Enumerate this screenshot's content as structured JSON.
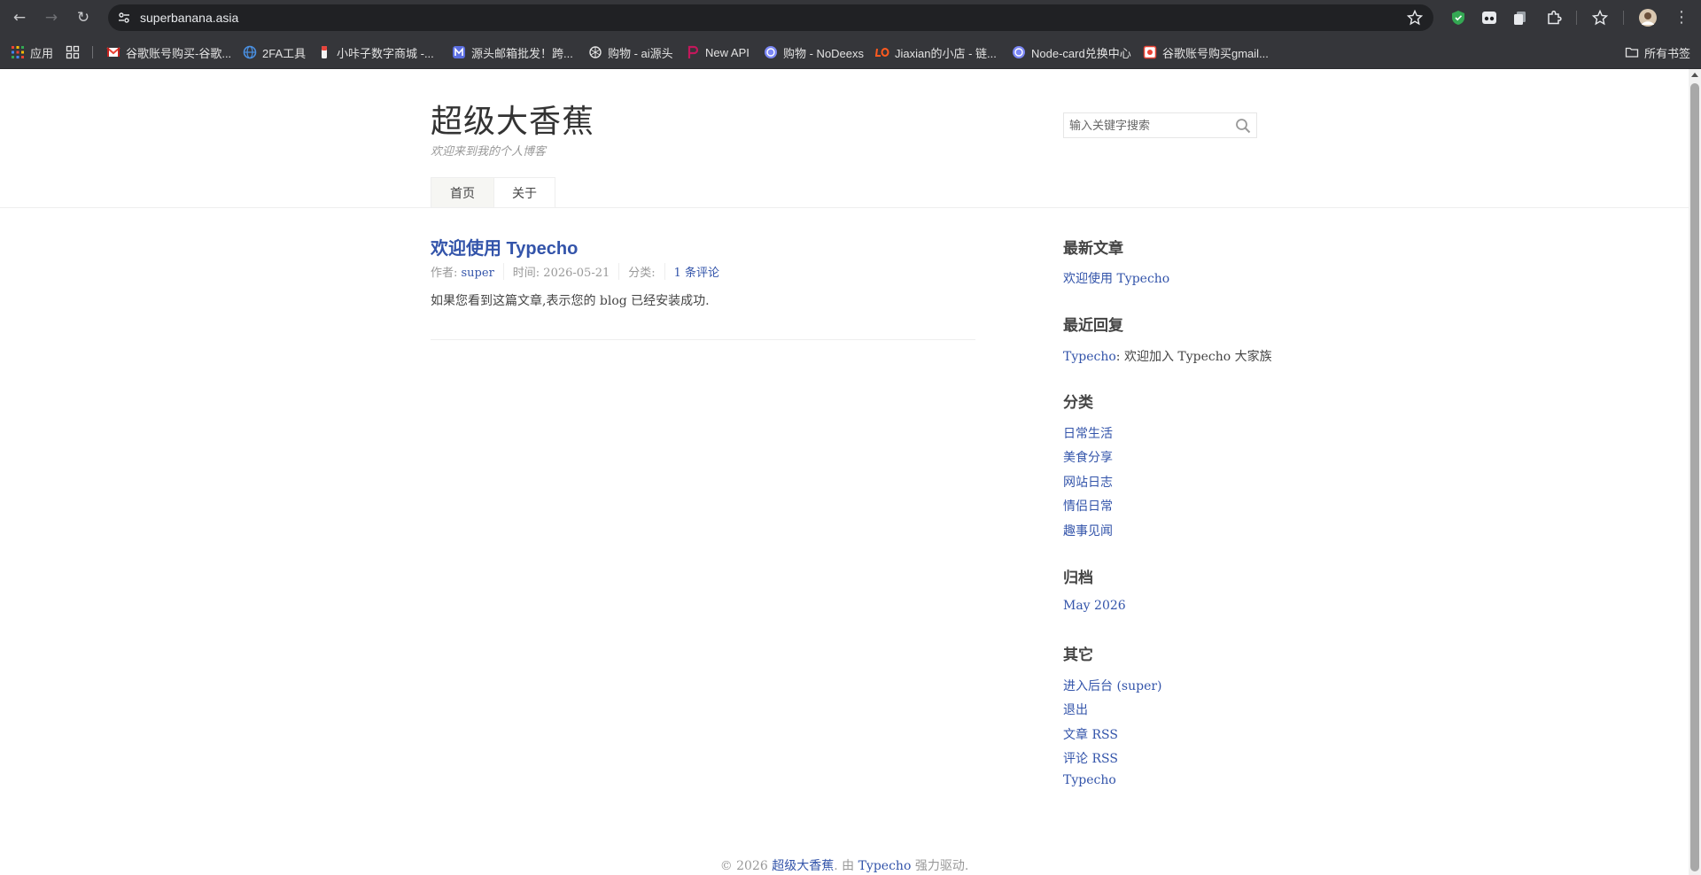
{
  "browser": {
    "url": "superbanana.asia",
    "bookmarks": [
      {
        "label": "应用",
        "icon": "apps-grid-icon"
      },
      {
        "label": "",
        "icon": "tab-groups-icon"
      },
      {
        "label": "谷歌账号购买-谷歌...",
        "icon": "gmail-icon"
      },
      {
        "label": "2FA工具",
        "icon": "globe-icon"
      },
      {
        "label": "小咔子数字商城 -...",
        "icon": "store-icon"
      },
      {
        "label": "源头邮箱批发！跨...",
        "icon": "mail-m-icon"
      },
      {
        "label": "购物 - ai源头",
        "icon": "openai-icon"
      },
      {
        "label": "New API",
        "icon": "p-logo-icon"
      },
      {
        "label": "购物 - NoDeexs",
        "icon": "openai-icon"
      },
      {
        "label": "Jiaxian的小店 - 链...",
        "icon": "lo-logo-icon"
      },
      {
        "label": "Node-card兑换中心",
        "icon": "openai-icon"
      },
      {
        "label": "谷歌账号购买gmail...",
        "icon": "gmail-stamp-icon"
      }
    ],
    "all_bookmarks": "所有书签"
  },
  "site": {
    "title": "超级大香蕉",
    "description": "欢迎来到我的个人博客",
    "search_placeholder": "输入关键字搜索",
    "nav": [
      "首页",
      "关于"
    ]
  },
  "post": {
    "title": "欢迎使用 Typecho",
    "author_label": "作者: ",
    "author": "super",
    "time_label": "时间: 2026-05-21",
    "category_label": "分类: ",
    "comments": "1 条评论",
    "content": "如果您看到这篇文章,表示您的 blog 已经安装成功."
  },
  "sidebar": {
    "recent_posts_title": "最新文章",
    "recent_posts": [
      "欢迎使用 Typecho"
    ],
    "recent_comments_title": "最近回复",
    "recent_comment_author": "Typecho",
    "recent_comment_text": ": 欢迎加入 Typecho 大家族",
    "categories_title": "分类",
    "categories": [
      "日常生活",
      "美食分享",
      "网站日志",
      "情侣日常",
      "趣事见闻"
    ],
    "archives_title": "归档",
    "archives": [
      "May 2026"
    ],
    "other_title": "其它",
    "other": [
      "进入后台 (super)",
      "退出",
      "文章 RSS",
      "评论 RSS",
      "Typecho"
    ]
  },
  "footer": {
    "copyright": "© 2026 ",
    "site_link": "超级大香蕉",
    "middle": ". 由 ",
    "powered_link": "Typecho",
    "suffix": " 强力驱动."
  }
}
